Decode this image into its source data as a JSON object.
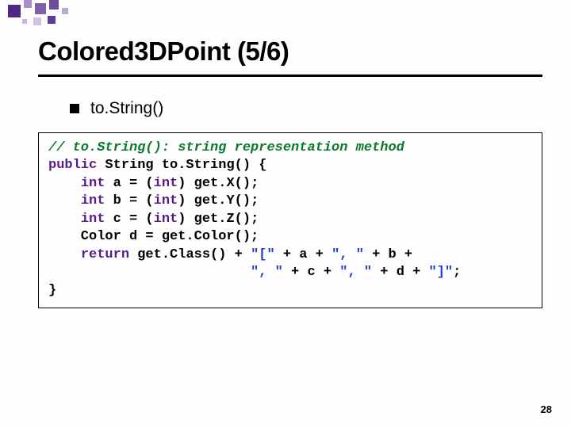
{
  "slide": {
    "title": "Colored3DPoint (5/6)",
    "bullet": "to.String()",
    "pagenum": "28"
  },
  "code": {
    "comment": "// to.String(): string representation method",
    "kw_public": "public",
    "t_string": " String to.String() {",
    "kw_int1": "int",
    "l_int1": " a = (",
    "kw_cast1": "int",
    "l_int1b": ") get.X();",
    "kw_int2": "int",
    "l_int2": " b = (",
    "kw_cast2": "int",
    "l_int2b": ") get.Y();",
    "kw_int3": "int",
    "l_int3": " c = (",
    "kw_cast3": "int",
    "l_int3b": ") get.Z();",
    "l_color": "    Color d = get.Color();",
    "kw_return": "return",
    "l_ret1": " get.Class() + ",
    "str_a": "\"[\"",
    "l_ret2": " + a + ",
    "str_b": "\", \"",
    "l_ret3": " + b +",
    "l_ret4pad": "                         ",
    "str_c": "\", \"",
    "l_ret5": " + c + ",
    "str_d": "\", \"",
    "l_ret6": " + d + ",
    "str_e": "\"]\"",
    "l_ret7": ";",
    "l_close": "}"
  }
}
